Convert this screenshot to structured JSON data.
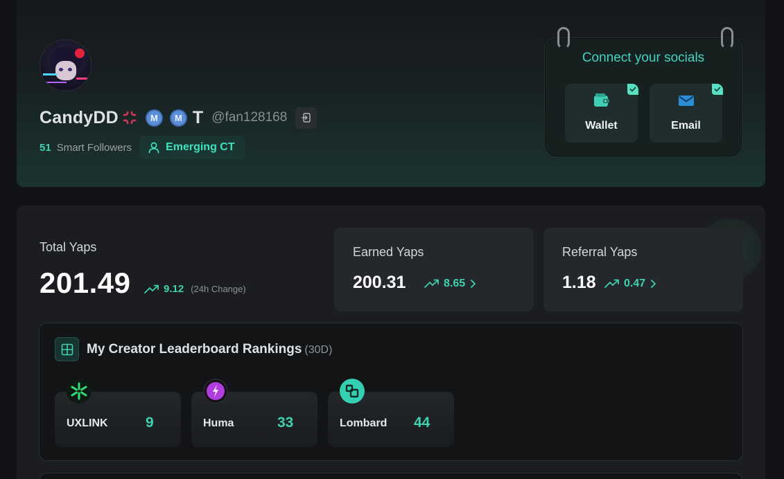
{
  "profile": {
    "display_name": "CandyDD",
    "t_letter": "T",
    "handle": "@fan128168",
    "m_badge_letter": "M",
    "smart_followers_count": "51",
    "smart_followers_label": "Smart Followers",
    "tier_label": "Emerging CT",
    "icons": [
      "angry-symbol-icon",
      "m-badge-icon",
      "copy-icon",
      "user-icon"
    ]
  },
  "socials": {
    "title": "Connect your socials",
    "wallet_label": "Wallet",
    "email_label": "Email",
    "wallet_connected": true,
    "email_connected": true
  },
  "yaps": {
    "total_label": "Total Yaps",
    "total_value": "201.49",
    "total_change": "9.12",
    "total_change_note": "(24h Change)",
    "earned_label": "Earned Yaps",
    "earned_value": "200.31",
    "earned_change": "8.65",
    "referral_label": "Referral Yaps",
    "referral_value": "1.18",
    "referral_change": "0.47"
  },
  "leaderboard": {
    "title": "My Creator Leaderboard Rankings",
    "period": "(30D)",
    "entries": [
      {
        "name": "UXLINK",
        "rank": "9"
      },
      {
        "name": "Huma",
        "rank": "33"
      },
      {
        "name": "Lombard",
        "rank": "44"
      }
    ]
  },
  "colors": {
    "accent": "#3ed2b0",
    "background": "#111316",
    "card": "#1b1d20"
  }
}
